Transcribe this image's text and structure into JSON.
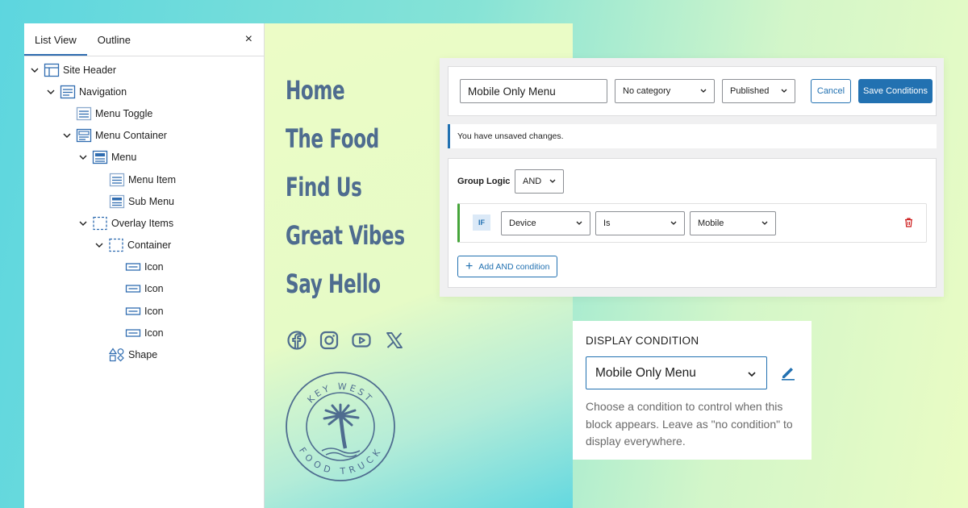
{
  "list_view": {
    "tabs": [
      "List View",
      "Outline"
    ],
    "close_label": "×",
    "items": [
      {
        "label": "Site Header",
        "icon": "header-block-icon",
        "expanded": true
      },
      {
        "label": "Navigation",
        "icon": "navigation-block-icon",
        "expanded": true
      },
      {
        "label": "Menu Toggle",
        "icon": "menu-toggle-icon"
      },
      {
        "label": "Menu Container",
        "icon": "menu-container-icon",
        "expanded": true
      },
      {
        "label": "Menu",
        "icon": "menu-block-icon",
        "expanded": true
      },
      {
        "label": "Menu Item",
        "icon": "menu-item-icon"
      },
      {
        "label": "Sub Menu",
        "icon": "sub-menu-icon"
      },
      {
        "label": "Overlay Items",
        "icon": "overlay-dashed-icon",
        "expanded": true
      },
      {
        "label": "Container",
        "icon": "container-dashed-icon",
        "expanded": true
      },
      {
        "label": "Icon",
        "icon": "icon-block-icon"
      },
      {
        "label": "Icon",
        "icon": "icon-block-icon"
      },
      {
        "label": "Icon",
        "icon": "icon-block-icon"
      },
      {
        "label": "Icon",
        "icon": "icon-block-icon"
      },
      {
        "label": "Shape",
        "icon": "shapes-icon"
      }
    ]
  },
  "preview": {
    "nav_links": [
      "Home",
      "The Food",
      "Find Us",
      "Great Vibes",
      "Say Hello"
    ],
    "social_icons": [
      "facebook-icon",
      "instagram-icon",
      "youtube-icon",
      "x-icon"
    ],
    "logo": {
      "top_text": "KEY WEST",
      "bottom_text": "FOOD TRUCK"
    },
    "link_color": "#4e6c8f"
  },
  "conditions_editor": {
    "title_value": "Mobile Only Menu",
    "category": "No category",
    "status": "Published",
    "cancel_label": "Cancel",
    "save_label": "Save Conditions",
    "notice": "You have unsaved changes.",
    "group_logic_label": "Group Logic",
    "group_logic_value": "AND",
    "condition": {
      "badge": "IF",
      "field": "Device",
      "operator": "Is",
      "value": "Mobile"
    },
    "add_condition_label": "Add AND condition",
    "accent_color": "#2271b1",
    "condition_bar_color": "#46a53a"
  },
  "display_condition": {
    "heading": "DISPLAY CONDITION",
    "selected": "Mobile Only Menu",
    "help_text": "Choose a condition to control when this block appears. Leave as \"no condition\" to display everywhere."
  }
}
